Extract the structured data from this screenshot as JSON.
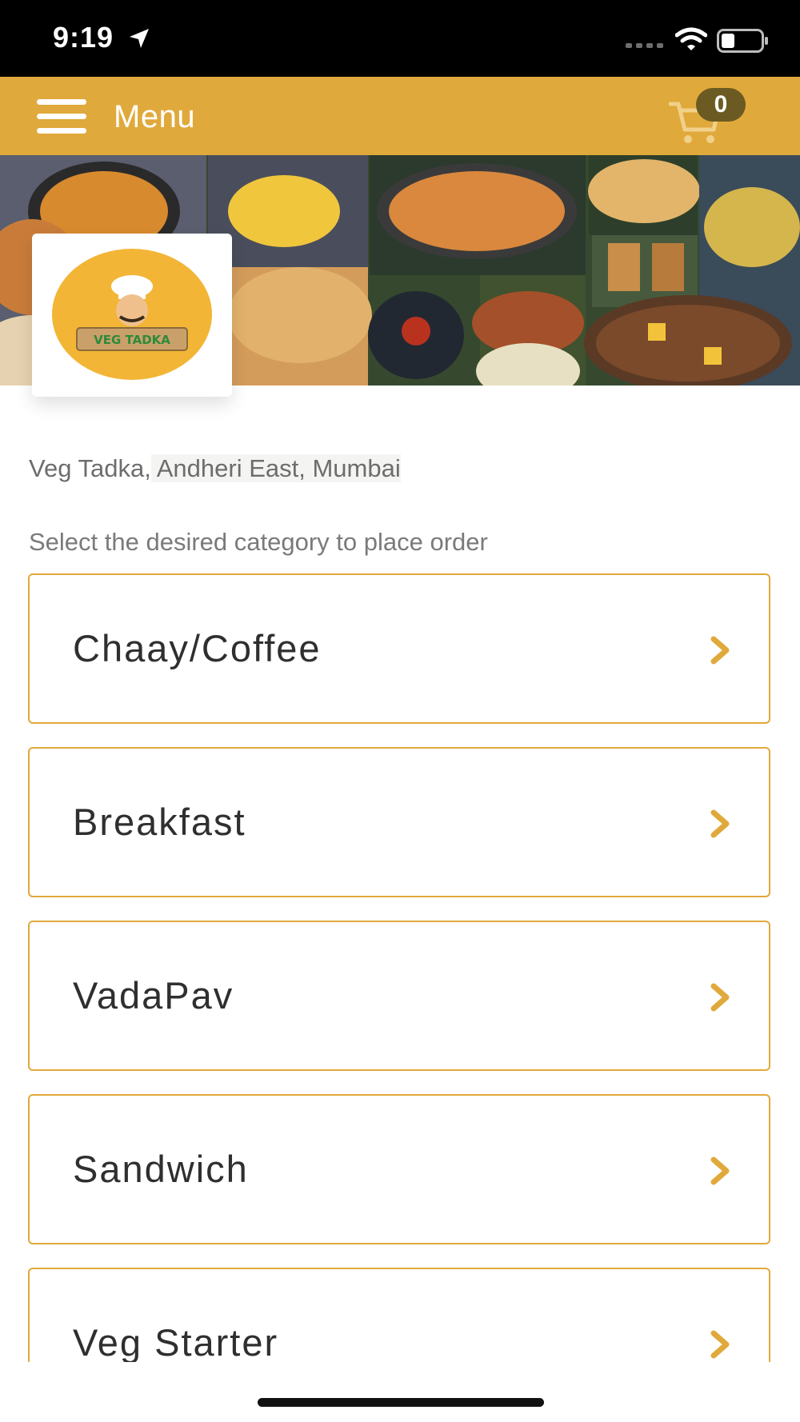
{
  "status_bar": {
    "time": "9:19"
  },
  "header": {
    "title": "Menu",
    "cart_count": "0"
  },
  "restaurant": {
    "name": "Veg Tadka,",
    "address": " Andheri East, Mumbai",
    "logo_text": "VEG TADKA"
  },
  "select_hint": "Select the desired category to place order",
  "categories": [
    {
      "label": "Chaay/Coffee"
    },
    {
      "label": "Breakfast"
    },
    {
      "label": "VadaPav"
    },
    {
      "label": "Sandwich"
    },
    {
      "label": "Veg Starter"
    }
  ],
  "colors": {
    "accent": "#e0a93b",
    "badge": "#6b5a22",
    "text_dark": "#2f2f2f",
    "text_muted": "#6d6d6d"
  },
  "icons": [
    "location-arrow-icon",
    "signal-icon",
    "wifi-icon",
    "battery-icon",
    "hamburger-menu-icon",
    "cart-icon",
    "chevron-right-icon"
  ]
}
